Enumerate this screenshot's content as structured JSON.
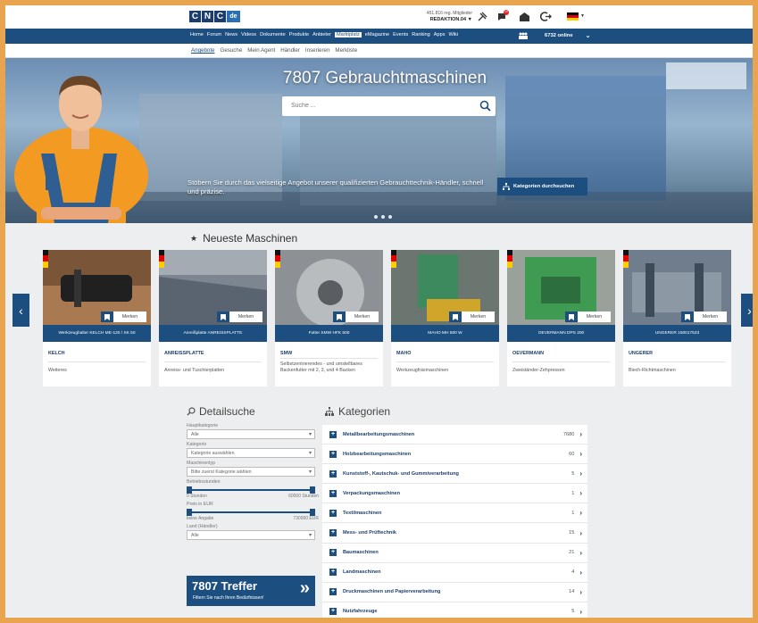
{
  "topbar": {
    "logo_letters": [
      "C",
      "N",
      "C",
      "de"
    ],
    "member_count": "451.816 reg. Mitglieder",
    "user": "REDAKTION.04 ▼",
    "notif_badge": "10"
  },
  "nav": {
    "links": [
      "Home",
      "Forum",
      "News",
      "Videos",
      "Dokumente",
      "Produkte",
      "Anbieter",
      "Marktplatz",
      "eMagazine",
      "Events",
      "Ranking",
      "Apps",
      "Wiki"
    ],
    "active_index": 7,
    "online": "6732 online"
  },
  "subnav": {
    "links": [
      "Angebote",
      "Gesuche",
      "Mein Agent",
      "Händler",
      "Inserieren",
      "Merkliste"
    ],
    "active_index": 0
  },
  "hero": {
    "title": "7807 Gebrauchtmaschinen",
    "search_placeholder": "Suche ...",
    "text": "Stöbern Sie durch das vielseitige Angebot unserer qualifizierten Gebrauchttechnik-Händler, schnell und präzise.",
    "button": "Kategorien durchsuchen"
  },
  "newest": {
    "title": "Neueste Maschinen",
    "merken_label": "Merken",
    "cards": [
      {
        "caption": "Werkzeughalter KELCH ME-120 / SK 50",
        "brand": "KELCH",
        "category": "Weiteres",
        "desc": ""
      },
      {
        "caption": "Anreißplatte ANREISSPLATTE",
        "brand": "ANREISSPLATTE",
        "category": "Anreiss- und Tuschierplatten",
        "desc": ""
      },
      {
        "caption": "Futter SMW HFK 500",
        "brand": "SMW",
        "category": "",
        "desc": "Selbstzentrierendes - und umstellbares Backenfutter mit 2, 3, und 4 Backen"
      },
      {
        "caption": "MAHO MH 500 W",
        "brand": "MAHO",
        "category": "Werkzeugfräsmaschinen",
        "desc": ""
      },
      {
        "caption": "OEVERMANN DPS 200",
        "brand": "OEVERMANN",
        "category": "Zweiständer-Zehpressen",
        "desc": ""
      },
      {
        "caption": "UNGERER 150017523",
        "brand": "UNGERER",
        "category": "Blech-Richtmaschinen",
        "desc": ""
      }
    ]
  },
  "filter": {
    "title": "Detailsuche",
    "hauptkategorie_label": "Hauptkategorie",
    "hauptkategorie_value": "Alle",
    "kategorie_label": "Kategorie",
    "kategorie_value": "Kategorie auswählen",
    "typ_label": "Maschinentyp",
    "typ_value": "Bitte zuerst Kategorie wählen",
    "betrieb_label": "Betriebsstunden",
    "betrieb_min": "0 Stunden",
    "betrieb_max": "60000 Stunden",
    "preis_label": "Preis in EUR",
    "preis_min": "keine Angabe",
    "preis_max": "730000 EUR",
    "land_label": "Land (Händler)",
    "land_value": "Alle",
    "treffer": "7807 Treffer",
    "treffer_sub": "Filtern Sie nach Ihren Bedürfnissen!"
  },
  "categories": {
    "title": "Kategorien",
    "items": [
      {
        "name": "Metallbearbeitungsmaschinen",
        "count": "7680"
      },
      {
        "name": "Holzbearbeitungsmaschinen",
        "count": "60"
      },
      {
        "name": "Kunststoff-, Kautschuk- und Gummiverarbeitung",
        "count": "5"
      },
      {
        "name": "Verpackungsmaschinen",
        "count": "1"
      },
      {
        "name": "Textilmaschinen",
        "count": "1"
      },
      {
        "name": "Mess- und Prüftechnik",
        "count": "15"
      },
      {
        "name": "Baumaschinen",
        "count": "21"
      },
      {
        "name": "Landmaschinen",
        "count": "4"
      },
      {
        "name": "Druckmaschinen und Papierverarbeitung",
        "count": "14"
      },
      {
        "name": "Nutzfahrzeuge",
        "count": "5"
      }
    ]
  },
  "colors": {
    "accent": "#1d4e80",
    "frame": "#e9a44f"
  }
}
